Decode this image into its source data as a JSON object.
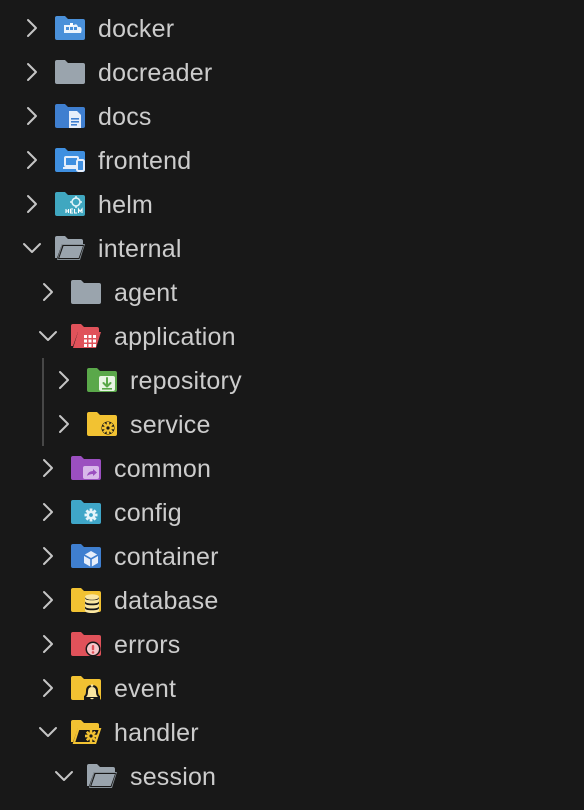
{
  "explorer": {
    "items": [
      {
        "label": "docker",
        "expanded": false,
        "icon": "docker-folder-icon",
        "color": "#4a90d9"
      },
      {
        "label": "docreader",
        "expanded": false,
        "icon": "folder-icon",
        "color": "#9aa4ad"
      },
      {
        "label": "docs",
        "expanded": false,
        "icon": "docs-folder-icon",
        "color": "#3f7fd0"
      },
      {
        "label": "frontend",
        "expanded": false,
        "icon": "frontend-folder-icon",
        "color": "#3f8fe0"
      },
      {
        "label": "helm",
        "expanded": false,
        "icon": "helm-folder-icon",
        "color": "#40a7c0"
      },
      {
        "label": "internal",
        "expanded": true,
        "icon": "folder-open-icon",
        "color": "#9aa4ad"
      },
      {
        "label": "agent",
        "expanded": false,
        "icon": "folder-icon",
        "color": "#9aa4ad"
      },
      {
        "label": "application",
        "expanded": true,
        "icon": "application-folder-icon",
        "color": "#e0525a"
      },
      {
        "label": "repository",
        "expanded": false,
        "icon": "repository-folder-icon",
        "color": "#5aa84a"
      },
      {
        "label": "service",
        "expanded": false,
        "icon": "service-folder-icon",
        "color": "#f2c232"
      },
      {
        "label": "common",
        "expanded": false,
        "icon": "common-folder-icon",
        "color": "#9b4fc0"
      },
      {
        "label": "config",
        "expanded": false,
        "icon": "config-folder-icon",
        "color": "#3fa6c8"
      },
      {
        "label": "container",
        "expanded": false,
        "icon": "container-folder-icon",
        "color": "#3f7fd0"
      },
      {
        "label": "database",
        "expanded": false,
        "icon": "database-folder-icon",
        "color": "#f2c232"
      },
      {
        "label": "errors",
        "expanded": false,
        "icon": "errors-folder-icon",
        "color": "#e0525a"
      },
      {
        "label": "event",
        "expanded": false,
        "icon": "event-folder-icon",
        "color": "#f2c232"
      },
      {
        "label": "handler",
        "expanded": true,
        "icon": "handler-folder-open-icon",
        "color": "#f2c232"
      },
      {
        "label": "session",
        "expanded": true,
        "icon": "folder-open-icon",
        "color": "#9aa4ad"
      }
    ]
  }
}
